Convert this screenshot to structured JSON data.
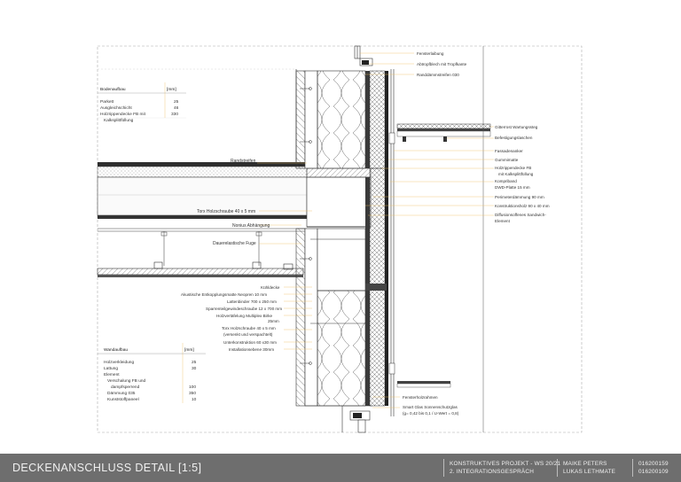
{
  "labels_right": [
    "Fensterlaibung",
    "Abtropfblech mit Tropfkante",
    "Randdämmstreifen 030",
    "Gitterrost Wartungssteg",
    "Befestigungslaschen",
    "Fassadenanker",
    "Gummimatte",
    "Holzrippendecke FB",
    "mit Kalksplittfüllung",
    "Kompriband",
    "DWD-Platte 15 mm",
    "Perimeterdämmung 90 mm",
    "Konstruktionsholz 90 x 40 mm",
    "Diffusionsoffenes Sandwich-",
    "Element",
    "Fensterholzrahmen",
    "Smart Glas Sonnenschutzglas",
    "(g= 0,42 bis 0,1 / U-Wert = 0,8)"
  ],
  "labels_center": [
    "Randstreifen",
    "Torx Holzschraube 40 x 5 mm",
    "Nonius Abhängung",
    "Dauerelastische Fuge",
    "Kühldecke",
    "Akustische Entkopplungsmatte Neopren 10 mm",
    "Lattenbinder 700 x 250 mm",
    "Sparrenteilgewindeschraube 12 x 700 mm",
    "Holzvertäfelung Multiplex Birke",
    "25mm",
    "Torx Holzschraube 40 x 5 mm",
    "(versenkt und verspachtelt)",
    "Unterkonstruktion 60 x30 mm",
    "Installationsebene 30mm"
  ],
  "floor_table": {
    "title": "Bodenaufbau",
    "unit": "[mm]",
    "rows": [
      {
        "name": "Parkett",
        "value": "25"
      },
      {
        "name": "Ausgleichschicht",
        "value": "46"
      },
      {
        "name": "Holzrippendecke FB mit",
        "value": "330"
      },
      {
        "name": "Kalksplittfüllung",
        "value": ""
      }
    ]
  },
  "wall_table": {
    "title": "Wandaufbau",
    "unit": "[mm]",
    "rows": [
      {
        "name": "Holzverkleidung",
        "value": "25"
      },
      {
        "name": "Lattung",
        "value": "30"
      },
      {
        "name": "Element",
        "value": ""
      },
      {
        "name": "Verschalung FB und",
        "value": ""
      },
      {
        "name": "dampfsperrend",
        "value": "100"
      },
      {
        "name": "Dämmung 035",
        "value": "350"
      },
      {
        "name": "Kunststoffpaneel",
        "value": "10"
      }
    ]
  },
  "footer": {
    "title": "DECKENANSCHLUSS DETAIL [1:5]",
    "project_line1": "KONSTRUKTIVES PROJEKT - WS 20/21",
    "project_line2": "2. INTEGRATIONSGESPRÄCH",
    "name1": "MAIKE PETERS",
    "name2": "LUKAS LETHMATE",
    "id1": "016200159",
    "id2": "016200109"
  }
}
